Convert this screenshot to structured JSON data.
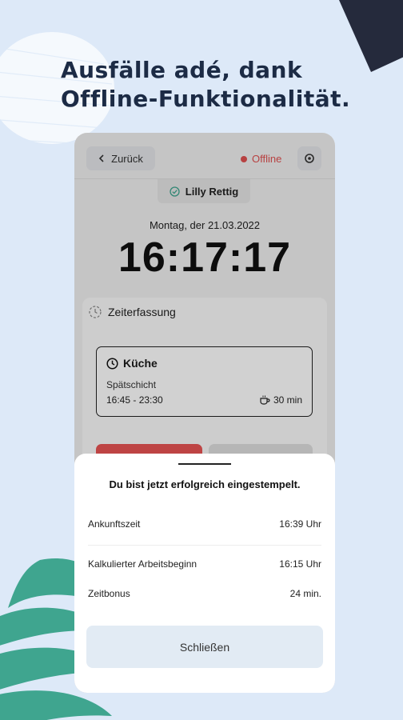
{
  "headline": {
    "line1": "Ausfälle adé, dank",
    "line2": "Offline-Funktionalität."
  },
  "app": {
    "back_label": "Zurück",
    "status_label": "Offline",
    "user_name": "Lilly Rettig",
    "date": "Montag, der 21.03.2022",
    "time": "16:17:17",
    "section_title": "Zeiterfassung",
    "shift": {
      "name": "Küche",
      "type": "Spätschicht",
      "time": "16:45 - 23:30",
      "break": "30 min"
    }
  },
  "sheet": {
    "title": "Du bist jetzt erfolgreich eingestempelt.",
    "rows": [
      {
        "label": "Ankunftszeit",
        "value": "16:39 Uhr"
      },
      {
        "label": "Kalkulierter Arbeitsbeginn",
        "value": "16:15 Uhr"
      },
      {
        "label": "Zeitbonus",
        "value": "24 min."
      }
    ],
    "close_label": "Schließen"
  },
  "colors": {
    "background": "#dde9f8",
    "headline": "#1c2b45",
    "offline": "#e05050",
    "accent_green": "#3fa58f",
    "decor_dark": "#252a3c"
  },
  "icons": [
    "chevron-left-icon",
    "gear-icon",
    "check-circle-icon",
    "clock-icon",
    "coffee-cup-icon"
  ]
}
